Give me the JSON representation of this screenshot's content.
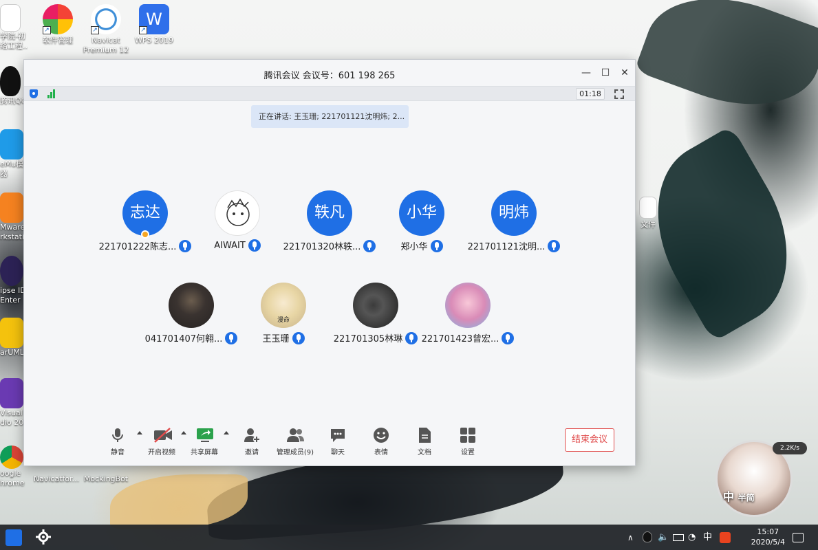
{
  "desktop": {
    "icons": [
      {
        "label": "学院-初\n络工程..."
      },
      {
        "label": "软件管理"
      },
      {
        "label": "Navicat\nPremium 12"
      },
      {
        "label": "WPS 2019"
      },
      {
        "label": "腾讯QQ"
      },
      {
        "label": "eMu模\n器"
      },
      {
        "label": "Mware\nrkstati"
      },
      {
        "label": "ipse ID\nEnter"
      },
      {
        "label": "arUML"
      },
      {
        "label": "Visual\ndio 20"
      },
      {
        "label": "oogle\nhrome"
      },
      {
        "label": "Navicatfor..."
      },
      {
        "label": "MockingBot"
      },
      {
        "label": "文件"
      }
    ]
  },
  "window": {
    "title": "腾讯会议 会议号：601 198 265",
    "minimize": "—",
    "maximize": "☐",
    "close": "✕",
    "timer": "01:18",
    "speaking": "正在讲话: 王玉珊; 221701121沈明炜; 2..."
  },
  "participants": [
    {
      "avatar_text": "志达",
      "name": "221701222陈志...",
      "host": true
    },
    {
      "avatar_text": "",
      "name": "AIWAIT"
    },
    {
      "avatar_text": "轶凡",
      "name": "221701320林轶..."
    },
    {
      "avatar_text": "小华",
      "name": "郑小华"
    },
    {
      "avatar_text": "明炜",
      "name": "221701121沈明..."
    },
    {
      "avatar_text": "",
      "name": "041701407何翱..."
    },
    {
      "avatar_text": "",
      "name": "王玉珊",
      "avatar_caption": "漫命"
    },
    {
      "avatar_text": "",
      "name": "221701305林琳"
    },
    {
      "avatar_text": "",
      "name": "221701423曾宏..."
    }
  ],
  "toolbar": {
    "mute": "静音",
    "video": "开启视频",
    "share": "共享屏幕",
    "invite": "邀请",
    "members": "管理成员(9)",
    "chat": "聊天",
    "emoji": "表情",
    "docs": "文档",
    "settings": "设置",
    "end": "结束会议"
  },
  "taskbar": {
    "time": "15:07",
    "date": "2020/5/4",
    "ime": "中"
  },
  "widget": {
    "speed": "2.2K/s",
    "ime_label": "中",
    "sub_label": "半简"
  },
  "colors": {
    "accent": "#1f6fe5",
    "end": "#e04b4b",
    "signal": "#21b04b"
  }
}
